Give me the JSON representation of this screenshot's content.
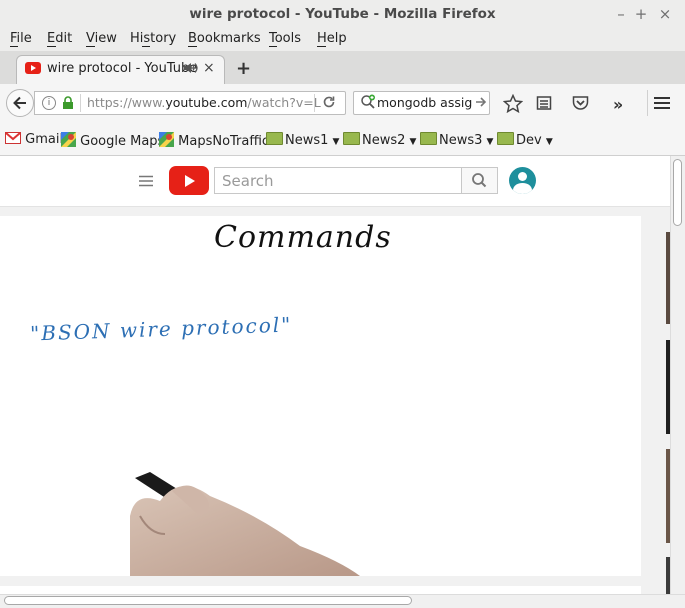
{
  "window": {
    "title": "wire protocol - YouTube - Mozilla Firefox",
    "controls": {
      "minimize": "–",
      "maximize": "+",
      "close": "×"
    }
  },
  "menu": [
    {
      "label": "File"
    },
    {
      "label": "Edit"
    },
    {
      "label": "View"
    },
    {
      "label": "History"
    },
    {
      "label": "Bookmarks"
    },
    {
      "label": "Tools"
    },
    {
      "label": "Help"
    }
  ],
  "tab": {
    "label": "wire protocol - YouTube",
    "close": "×",
    "new_tab": "+"
  },
  "navbar": {
    "url_prefix": "https://www.",
    "url_domain": "youtube.com",
    "url_path": "/watch?v=L",
    "search_value": "mongodb assign"
  },
  "bookmarks": [
    {
      "label": "Gmail"
    },
    {
      "label": "Google Maps"
    },
    {
      "label": "MapsNoTraffic"
    },
    {
      "label": "News1"
    },
    {
      "label": "News2"
    },
    {
      "label": "News3"
    },
    {
      "label": "Dev"
    }
  ],
  "youtube": {
    "search_placeholder": "Search"
  },
  "video": {
    "heading": "Commands",
    "note": "\"BSON wire protocol\""
  },
  "colors": {
    "youtube_red": "#e62117",
    "handwriting_blue": "#2d6fb4",
    "avatar_teal": "#1e8f9c"
  }
}
